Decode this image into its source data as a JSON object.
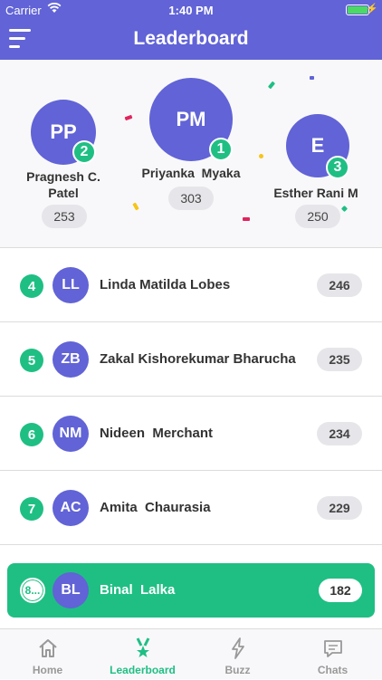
{
  "status_bar": {
    "carrier": "Carrier",
    "time": "1:40 PM"
  },
  "header": {
    "title": "Leaderboard"
  },
  "podium": [
    {
      "initials": "PP",
      "rank": "2",
      "name": "Pragnesh C. Patel",
      "score": "253"
    },
    {
      "initials": "PM",
      "rank": "1",
      "name": "Priyanka  Myaka",
      "score": "303"
    },
    {
      "initials": "E",
      "rank": "3",
      "name": "Esther Rani M",
      "score": "250"
    }
  ],
  "rows": [
    {
      "rank": "4",
      "initials": "LL",
      "name": "Linda Matilda Lobes",
      "score": "246"
    },
    {
      "rank": "5",
      "initials": "ZB",
      "name": "Zakal Kishorekumar Bharucha",
      "score": "235"
    },
    {
      "rank": "6",
      "initials": "NM",
      "name": "Nideen  Merchant",
      "score": "234"
    },
    {
      "rank": "7",
      "initials": "AC",
      "name": "Amita  Chaurasia",
      "score": "229"
    }
  ],
  "current_user": {
    "rank": "8...",
    "initials": "BL",
    "name": "Binal  Lalka",
    "score": "182"
  },
  "tabs": [
    {
      "label": "Home",
      "icon": "home-icon"
    },
    {
      "label": "Leaderboard",
      "icon": "trophy-icon"
    },
    {
      "label": "Buzz",
      "icon": "lightning-icon"
    },
    {
      "label": "Chats",
      "icon": "chat-icon"
    }
  ],
  "colors": {
    "brand": "#6163d6",
    "accent": "#1fbf84"
  }
}
